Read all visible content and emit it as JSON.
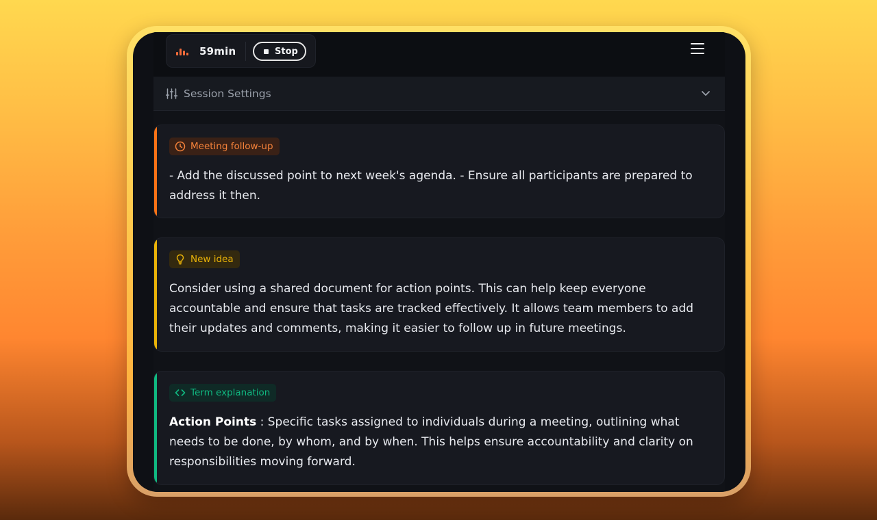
{
  "recorder": {
    "timer": "59min",
    "stop_label": "Stop",
    "wave_icon": "audio-wave-icon"
  },
  "menu": {
    "icon": "hamburger-menu-icon"
  },
  "settings": {
    "label": "Session Settings",
    "icon": "sliders-icon",
    "chevron": "chevron-down-icon"
  },
  "cards": [
    {
      "badge": "Meeting follow-up",
      "badge_icon": "clock-icon",
      "accent_color": "#f97316",
      "text": "- Add the discussed point to next week's agenda. - Ensure all participants are prepared to address it then."
    },
    {
      "badge": "New idea",
      "badge_icon": "lightbulb-icon",
      "accent_color": "#eab308",
      "text": "Consider using a shared document for action points. This can help keep everyone accountable and ensure that tasks are tracked effectively. It allows team members to add their updates and comments, making it easier to follow up in future meetings."
    },
    {
      "badge": "Term explanation",
      "badge_icon": "code-icon",
      "accent_color": "#10b981",
      "term": "Action Points",
      "separator": " : ",
      "text": "Specific tasks assigned to individuals during a meeting, outlining what needs to be done, by whom, and by when. This helps ensure accountability and clarity on responsibilities moving forward."
    }
  ]
}
